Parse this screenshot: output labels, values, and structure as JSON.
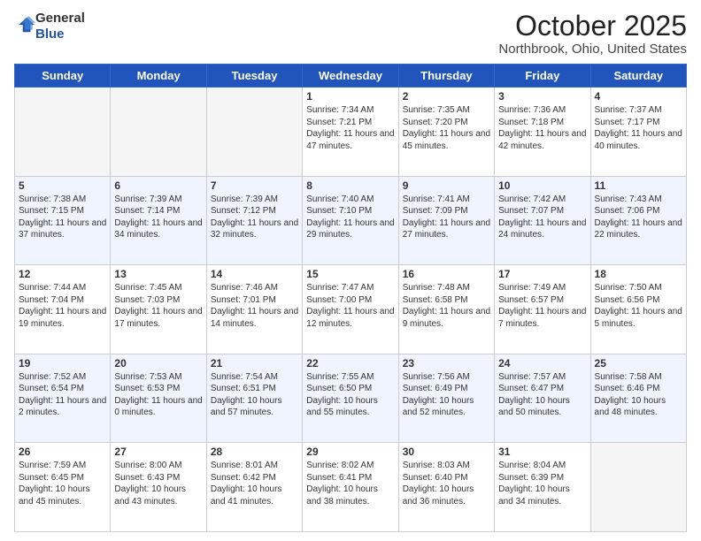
{
  "header": {
    "logo_general": "General",
    "logo_blue": "Blue",
    "month": "October 2025",
    "location": "Northbrook, Ohio, United States"
  },
  "days_of_week": [
    "Sunday",
    "Monday",
    "Tuesday",
    "Wednesday",
    "Thursday",
    "Friday",
    "Saturday"
  ],
  "weeks": [
    [
      {
        "num": "",
        "info": ""
      },
      {
        "num": "",
        "info": ""
      },
      {
        "num": "",
        "info": ""
      },
      {
        "num": "1",
        "info": "Sunrise: 7:34 AM\nSunset: 7:21 PM\nDaylight: 11 hours and 47 minutes."
      },
      {
        "num": "2",
        "info": "Sunrise: 7:35 AM\nSunset: 7:20 PM\nDaylight: 11 hours and 45 minutes."
      },
      {
        "num": "3",
        "info": "Sunrise: 7:36 AM\nSunset: 7:18 PM\nDaylight: 11 hours and 42 minutes."
      },
      {
        "num": "4",
        "info": "Sunrise: 7:37 AM\nSunset: 7:17 PM\nDaylight: 11 hours and 40 minutes."
      }
    ],
    [
      {
        "num": "5",
        "info": "Sunrise: 7:38 AM\nSunset: 7:15 PM\nDaylight: 11 hours and 37 minutes."
      },
      {
        "num": "6",
        "info": "Sunrise: 7:39 AM\nSunset: 7:14 PM\nDaylight: 11 hours and 34 minutes."
      },
      {
        "num": "7",
        "info": "Sunrise: 7:39 AM\nSunset: 7:12 PM\nDaylight: 11 hours and 32 minutes."
      },
      {
        "num": "8",
        "info": "Sunrise: 7:40 AM\nSunset: 7:10 PM\nDaylight: 11 hours and 29 minutes."
      },
      {
        "num": "9",
        "info": "Sunrise: 7:41 AM\nSunset: 7:09 PM\nDaylight: 11 hours and 27 minutes."
      },
      {
        "num": "10",
        "info": "Sunrise: 7:42 AM\nSunset: 7:07 PM\nDaylight: 11 hours and 24 minutes."
      },
      {
        "num": "11",
        "info": "Sunrise: 7:43 AM\nSunset: 7:06 PM\nDaylight: 11 hours and 22 minutes."
      }
    ],
    [
      {
        "num": "12",
        "info": "Sunrise: 7:44 AM\nSunset: 7:04 PM\nDaylight: 11 hours and 19 minutes."
      },
      {
        "num": "13",
        "info": "Sunrise: 7:45 AM\nSunset: 7:03 PM\nDaylight: 11 hours and 17 minutes."
      },
      {
        "num": "14",
        "info": "Sunrise: 7:46 AM\nSunset: 7:01 PM\nDaylight: 11 hours and 14 minutes."
      },
      {
        "num": "15",
        "info": "Sunrise: 7:47 AM\nSunset: 7:00 PM\nDaylight: 11 hours and 12 minutes."
      },
      {
        "num": "16",
        "info": "Sunrise: 7:48 AM\nSunset: 6:58 PM\nDaylight: 11 hours and 9 minutes."
      },
      {
        "num": "17",
        "info": "Sunrise: 7:49 AM\nSunset: 6:57 PM\nDaylight: 11 hours and 7 minutes."
      },
      {
        "num": "18",
        "info": "Sunrise: 7:50 AM\nSunset: 6:56 PM\nDaylight: 11 hours and 5 minutes."
      }
    ],
    [
      {
        "num": "19",
        "info": "Sunrise: 7:52 AM\nSunset: 6:54 PM\nDaylight: 11 hours and 2 minutes."
      },
      {
        "num": "20",
        "info": "Sunrise: 7:53 AM\nSunset: 6:53 PM\nDaylight: 11 hours and 0 minutes."
      },
      {
        "num": "21",
        "info": "Sunrise: 7:54 AM\nSunset: 6:51 PM\nDaylight: 10 hours and 57 minutes."
      },
      {
        "num": "22",
        "info": "Sunrise: 7:55 AM\nSunset: 6:50 PM\nDaylight: 10 hours and 55 minutes."
      },
      {
        "num": "23",
        "info": "Sunrise: 7:56 AM\nSunset: 6:49 PM\nDaylight: 10 hours and 52 minutes."
      },
      {
        "num": "24",
        "info": "Sunrise: 7:57 AM\nSunset: 6:47 PM\nDaylight: 10 hours and 50 minutes."
      },
      {
        "num": "25",
        "info": "Sunrise: 7:58 AM\nSunset: 6:46 PM\nDaylight: 10 hours and 48 minutes."
      }
    ],
    [
      {
        "num": "26",
        "info": "Sunrise: 7:59 AM\nSunset: 6:45 PM\nDaylight: 10 hours and 45 minutes."
      },
      {
        "num": "27",
        "info": "Sunrise: 8:00 AM\nSunset: 6:43 PM\nDaylight: 10 hours and 43 minutes."
      },
      {
        "num": "28",
        "info": "Sunrise: 8:01 AM\nSunset: 6:42 PM\nDaylight: 10 hours and 41 minutes."
      },
      {
        "num": "29",
        "info": "Sunrise: 8:02 AM\nSunset: 6:41 PM\nDaylight: 10 hours and 38 minutes."
      },
      {
        "num": "30",
        "info": "Sunrise: 8:03 AM\nSunset: 6:40 PM\nDaylight: 10 hours and 36 minutes."
      },
      {
        "num": "31",
        "info": "Sunrise: 8:04 AM\nSunset: 6:39 PM\nDaylight: 10 hours and 34 minutes."
      },
      {
        "num": "",
        "info": ""
      }
    ]
  ]
}
